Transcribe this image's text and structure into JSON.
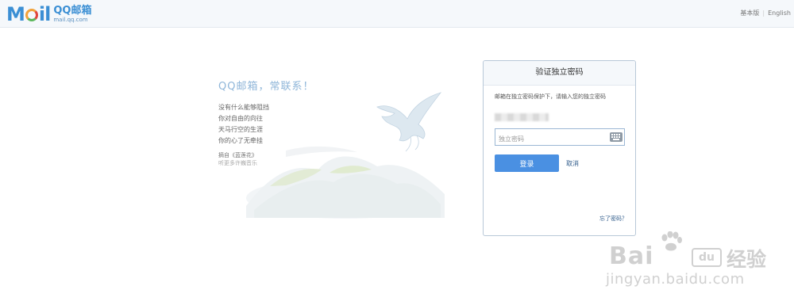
{
  "header": {
    "logo_mail": "M",
    "logo_mail_end": "il",
    "logo_cn": "QQ邮箱",
    "logo_url": "mail.qq.com",
    "links": {
      "basic": "基本版",
      "separator": "|",
      "english": "English"
    }
  },
  "promo": {
    "title": "QQ邮箱，常联系！",
    "poem": [
      "没有什么能够阻挡",
      "你对自由的向往",
      "天马行空的生涯",
      "你的心了无牵挂"
    ],
    "song": "摘自《蓝莲花》",
    "listen": "听更多许巍音乐"
  },
  "card": {
    "title": "验证独立密码",
    "tip": "邮箱在独立密码保护下，请输入您的独立密码",
    "password_placeholder": "独立密码",
    "login_label": "登录",
    "cancel_label": "取消",
    "forgot_label": "忘了密码？"
  },
  "watermark": {
    "brand": "Bai",
    "du": "du",
    "jingyan": "经验",
    "url": "jingyan.baidu.com"
  },
  "colors": {
    "accent": "#4a90e2",
    "link": "#335e8c",
    "header_bg": "#f5f8fb",
    "promo_title": "#8fb6d9"
  },
  "icons": {
    "keyboard": "keyboard-icon",
    "pegasus": "pegasus-illustration"
  }
}
